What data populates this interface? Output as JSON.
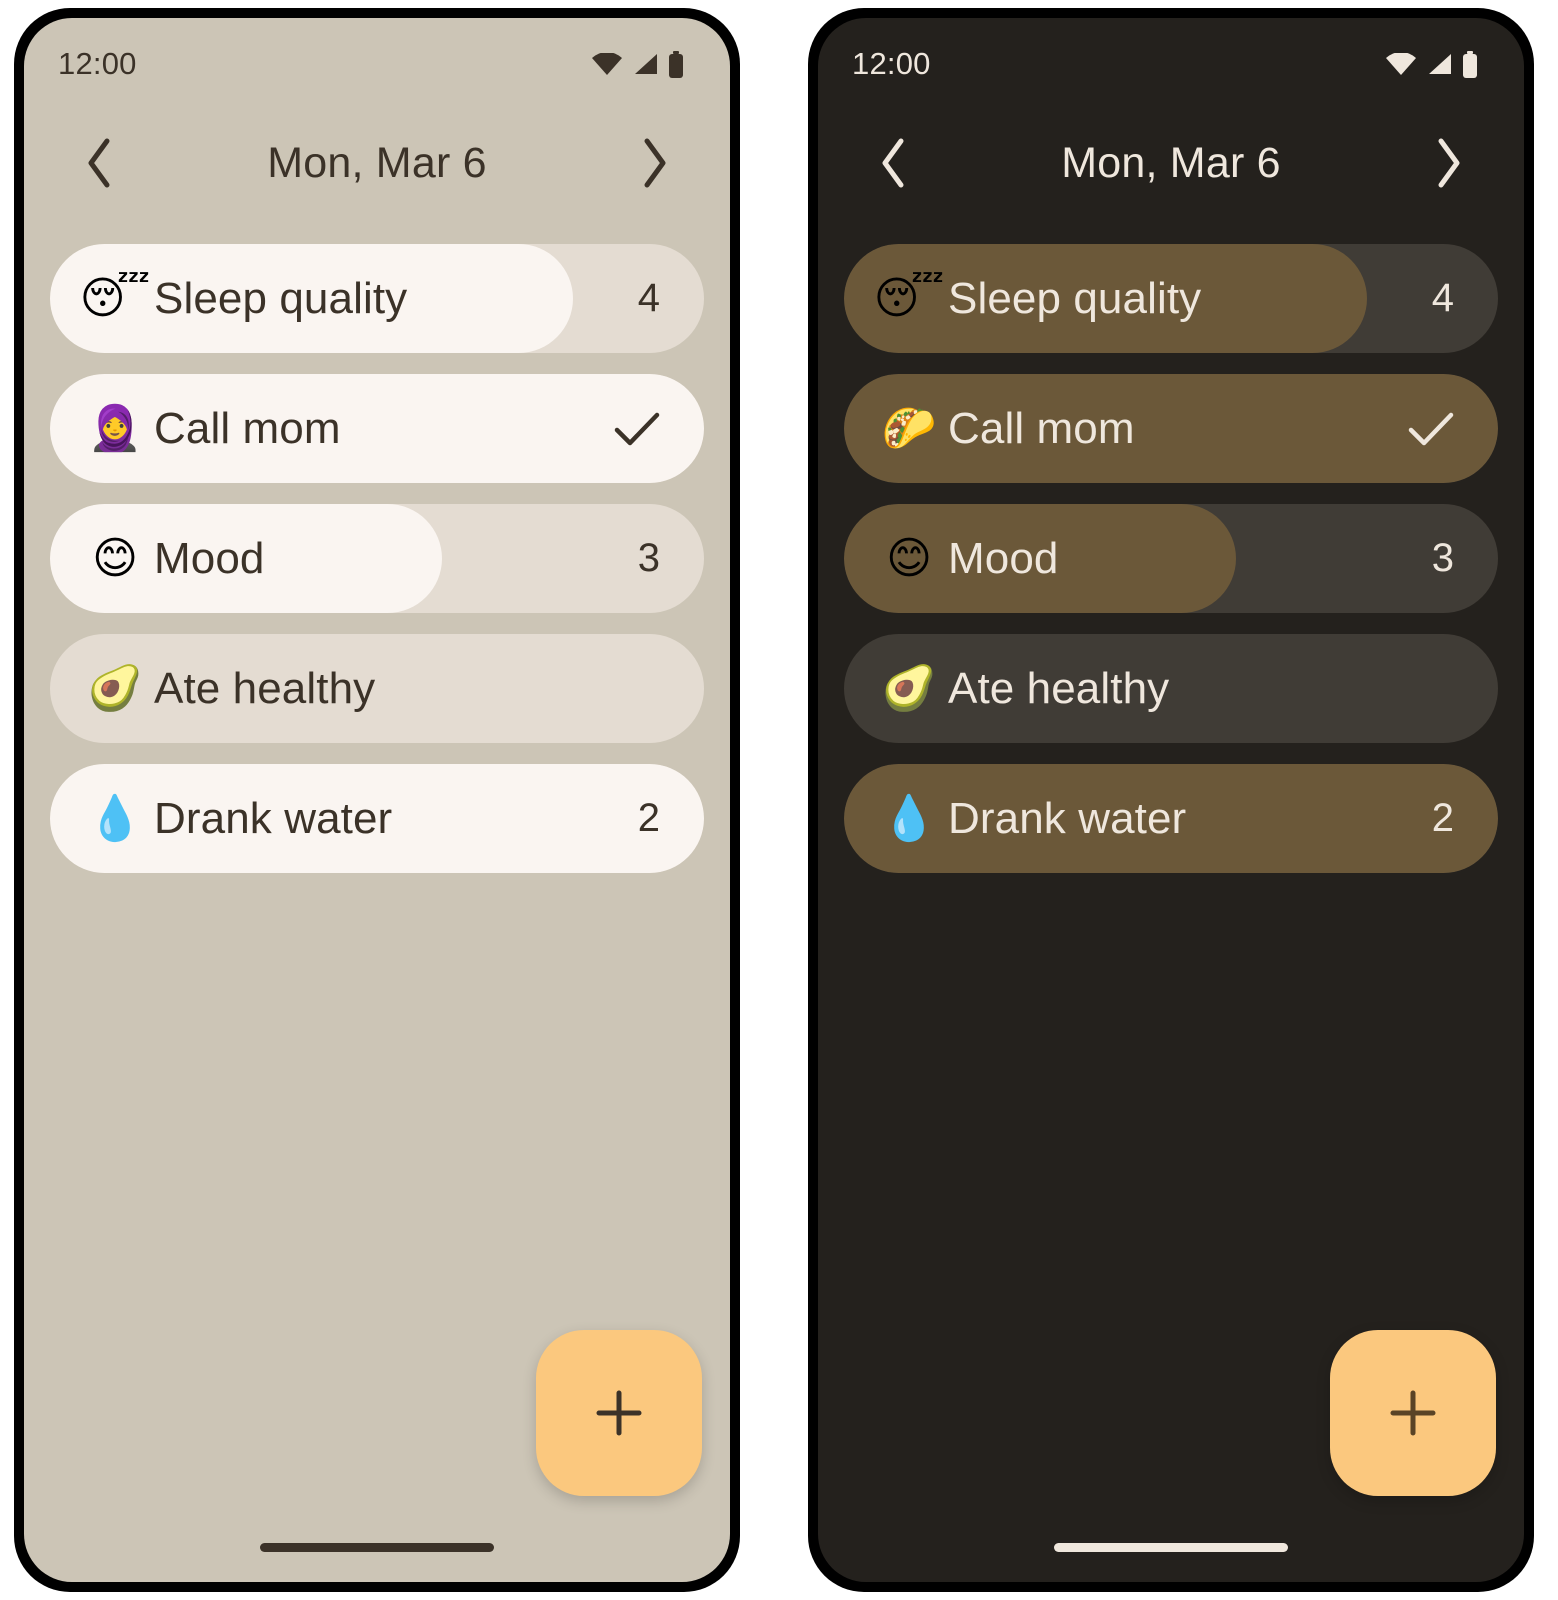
{
  "colors": {
    "light_background": "#CCC5B6",
    "light_track_empty": "#E4DCD2",
    "light_track_filled": "#FAF5F1",
    "light_on_surface": "#3B3228",
    "dark_background": "#24211D",
    "dark_track_empty": "#403C36",
    "dark_track_filled": "#6B5839",
    "dark_on_surface": "#EFE7DD",
    "accent_fab": "#FBC87E"
  },
  "panels": [
    {
      "theme": "light",
      "status_bar": {
        "time": "12:00",
        "icons": [
          "wifi-icon",
          "cellular-signal-icon",
          "battery-icon"
        ]
      },
      "header": {
        "prev_label": "‹",
        "prev_icon": "chevron-left-icon",
        "title": "Mon, Mar 6",
        "next_label": "›",
        "next_icon": "chevron-right-icon"
      },
      "habits": [
        {
          "emoji": "😴",
          "emoji_name": "sleeping-face-emoji",
          "label": "Sleep quality",
          "value": "4",
          "type": "numeric",
          "progress": 80
        },
        {
          "emoji": "🧕",
          "emoji_name": "woman-with-headscarf-emoji",
          "label": "Call mom",
          "value": "✓",
          "type": "checkbox",
          "progress": 100
        },
        {
          "emoji": "😊",
          "emoji_name": "smiling-face-emoji",
          "label": "Mood",
          "value": "3",
          "type": "numeric",
          "progress": 60
        },
        {
          "emoji": "🥑",
          "emoji_name": "avocado-emoji",
          "label": "Ate healthy",
          "value": "",
          "type": "checkbox",
          "progress": 0
        },
        {
          "emoji": "💧",
          "emoji_name": "droplet-emoji",
          "label": "Drank water",
          "value": "2",
          "type": "numeric",
          "progress": 100
        }
      ],
      "fab": {
        "label": "+",
        "icon": "plus-icon"
      }
    },
    {
      "theme": "dark",
      "status_bar": {
        "time": "12:00",
        "icons": [
          "wifi-icon",
          "cellular-signal-icon",
          "battery-icon"
        ]
      },
      "header": {
        "prev_label": "‹",
        "prev_icon": "chevron-left-icon",
        "title": "Mon, Mar 6",
        "next_label": "›",
        "next_icon": "chevron-right-icon"
      },
      "habits": [
        {
          "emoji": "😴",
          "emoji_name": "sleeping-face-emoji",
          "label": "Sleep quality",
          "value": "4",
          "type": "numeric",
          "progress": 80
        },
        {
          "emoji": "🌮",
          "emoji_name": "taco-emoji",
          "label": "Call mom",
          "value": "✓",
          "type": "checkbox",
          "progress": 100
        },
        {
          "emoji": "😊",
          "emoji_name": "smiling-face-emoji",
          "label": "Mood",
          "value": "3",
          "type": "numeric",
          "progress": 60
        },
        {
          "emoji": "🥑",
          "emoji_name": "avocado-emoji",
          "label": "Ate healthy",
          "value": "",
          "type": "checkbox",
          "progress": 0
        },
        {
          "emoji": "💧",
          "emoji_name": "droplet-emoji",
          "label": "Drank water",
          "value": "2",
          "type": "numeric",
          "progress": 100
        }
      ],
      "fab": {
        "label": "+",
        "icon": "plus-icon"
      }
    }
  ]
}
